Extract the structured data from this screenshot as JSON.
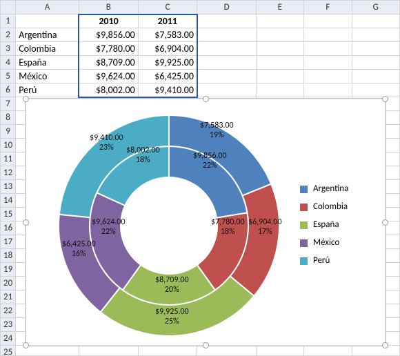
{
  "columns": [
    "A",
    "B",
    "C",
    "D",
    "E",
    "F",
    "G"
  ],
  "header_row": {
    "A": "",
    "B": "2010",
    "C": "2011"
  },
  "rows": [
    {
      "A": "Argentina",
      "B": "$9,856.00",
      "C": "$7,583.00"
    },
    {
      "A": "Colombia",
      "B": "$7,780.00",
      "C": "$6,904.00"
    },
    {
      "A": "España",
      "B": "$8,709.00",
      "C": "$9,925.00"
    },
    {
      "A": "México",
      "B": "$9,624.00",
      "C": "$6,425.00"
    },
    {
      "A": "Perú",
      "B": "$8,002.00",
      "C": "$9,410.00"
    }
  ],
  "legend": [
    {
      "label": "Argentina",
      "color": "#4f81bd"
    },
    {
      "label": "Colombia",
      "color": "#c0504d"
    },
    {
      "label": "España",
      "color": "#9bbb59"
    },
    {
      "label": "México",
      "color": "#8064a2"
    },
    {
      "label": "Perú",
      "color": "#4bacc6"
    }
  ],
  "chart_data": {
    "type": "pie",
    "subtype": "doughnut-multi-ring",
    "categories": [
      "Argentina",
      "Colombia",
      "España",
      "México",
      "Perú"
    ],
    "colors": [
      "#4f81bd",
      "#c0504d",
      "#9bbb59",
      "#8064a2",
      "#4bacc6"
    ],
    "series": [
      {
        "name": "2010",
        "values": [
          9856,
          7780,
          8709,
          9624,
          8002
        ],
        "percent": [
          22,
          18,
          20,
          22,
          18
        ]
      },
      {
        "name": "2011",
        "values": [
          7583,
          6904,
          9925,
          6425,
          9410
        ],
        "percent": [
          19,
          17,
          25,
          16,
          23
        ]
      }
    ],
    "labels_inner": [
      {
        "text_value": "$9,856.00",
        "text_pct": "22%"
      },
      {
        "text_value": "$7,780.00",
        "text_pct": "18%"
      },
      {
        "text_value": "$8,709.00",
        "text_pct": "20%"
      },
      {
        "text_value": "$9,624.00",
        "text_pct": "22%"
      },
      {
        "text_value": "$8,002.00",
        "text_pct": "18%"
      }
    ],
    "labels_outer": [
      {
        "text_value": "$7,583.00",
        "text_pct": "19%"
      },
      {
        "text_value": "$6,904.00",
        "text_pct": "17%"
      },
      {
        "text_value": "$9,925.00",
        "text_pct": "25%"
      },
      {
        "text_value": "$6,425.00",
        "text_pct": "16%"
      },
      {
        "text_value": "$9,410.00",
        "text_pct": "23%"
      }
    ]
  }
}
